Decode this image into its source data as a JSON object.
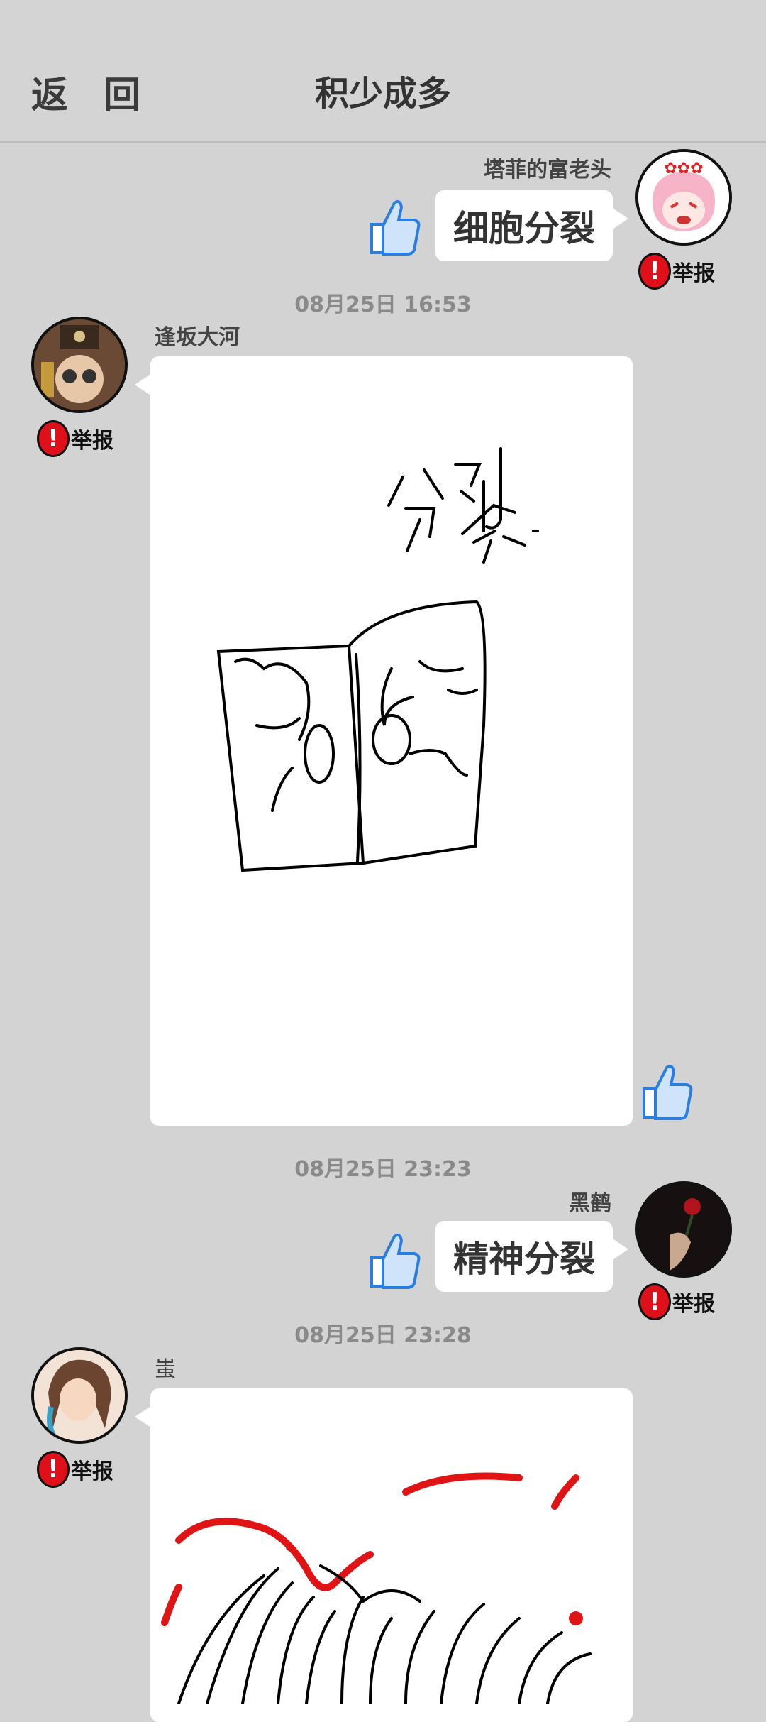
{
  "header": {
    "back_label": "返 回",
    "title": "积少成多"
  },
  "messages": [
    {
      "nickname": "塔菲的富老头",
      "text": "细胞分裂",
      "report_label": "举报"
    },
    {
      "time": "08月25日  16:53",
      "nickname": "逢坂大河",
      "report_label": "举报",
      "drawing_text": "分裂"
    },
    {
      "time": "08月25日  23:23",
      "nickname": "黑鹤",
      "text": "精神分裂",
      "report_label": "举报"
    },
    {
      "time": "08月25日  23:28",
      "nickname": "蚩",
      "report_label": "举报"
    }
  ],
  "icons": {
    "like": "thumbs-up-icon",
    "report": "exclamation-icon"
  },
  "colors": {
    "background": "#d3d3d3",
    "report_red": "#e0101a",
    "like_blue": "#2a7de1",
    "bubble": "#ffffff"
  }
}
